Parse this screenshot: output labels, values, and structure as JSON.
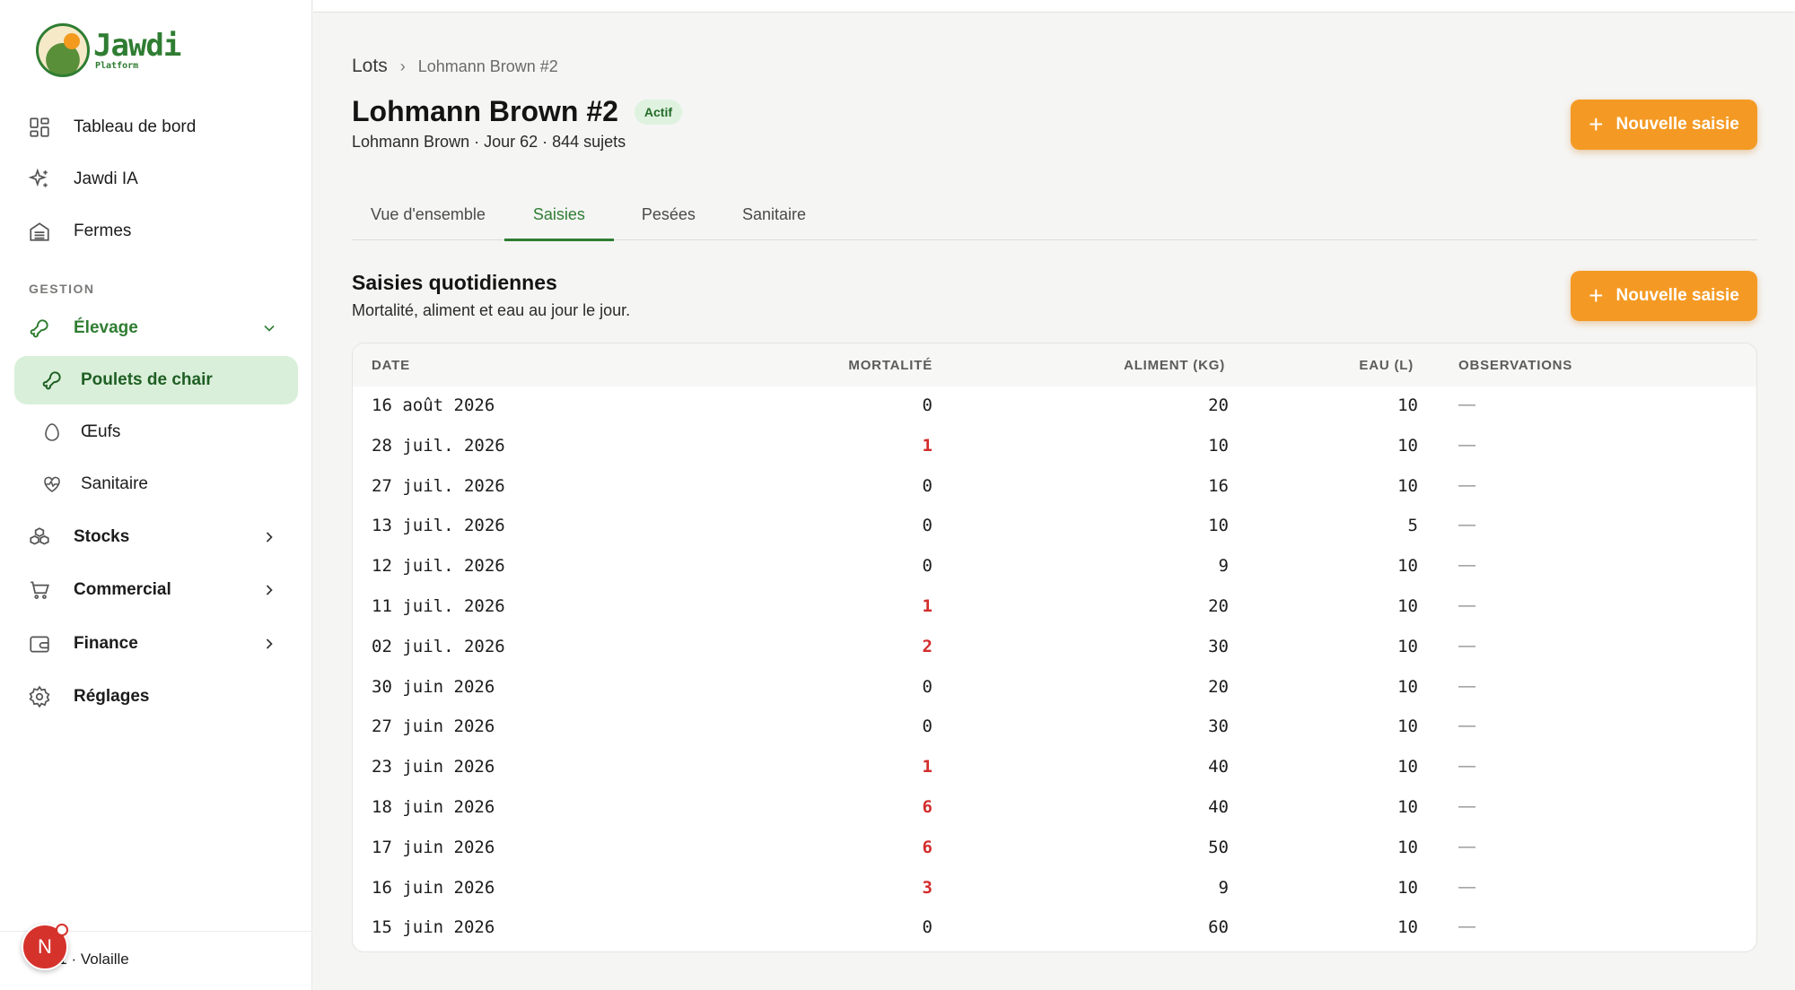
{
  "logo": {
    "name": "Jawdi",
    "sub": "Platform"
  },
  "nav": {
    "dashboard": "Tableau de bord",
    "ai": "Jawdi IA",
    "farms": "Fermes",
    "section": "GESTION",
    "breeding": "Élevage",
    "broilers": "Poulets de chair",
    "eggs": "Œufs",
    "health": "Sanitaire",
    "stocks": "Stocks",
    "commercial": "Commercial",
    "finance": "Finance",
    "settings": "Réglages"
  },
  "footer": {
    "avatar": "N",
    "version": "di V1 · Volaille"
  },
  "breadcrumb": {
    "root": "Lots",
    "current": "Lohmann Brown #2"
  },
  "header": {
    "title": "Lohmann Brown #2",
    "badge": "Actif",
    "subtitle": "Lohmann Brown · Jour 62 · 844 sujets",
    "new_entry": "Nouvelle saisie"
  },
  "tabs": [
    "Vue d'ensemble",
    "Saisies",
    "Pesées",
    "Sanitaire"
  ],
  "section": {
    "title": "Saisies quotidiennes",
    "desc": "Mortalité, aliment et eau au jour le jour.",
    "new_entry": "Nouvelle saisie"
  },
  "table": {
    "headers": [
      "DATE",
      "MORTALITÉ",
      "ALIMENT (KG)",
      "EAU (L)",
      "OBSERVATIONS"
    ],
    "rows": [
      [
        "16 août 2026",
        "0",
        "20",
        "10",
        "—"
      ],
      [
        "28 juil. 2026",
        "1",
        "10",
        "10",
        "—"
      ],
      [
        "27 juil. 2026",
        "0",
        "16",
        "10",
        "—"
      ],
      [
        "13 juil. 2026",
        "0",
        "10",
        "5",
        "—"
      ],
      [
        "12 juil. 2026",
        "0",
        "9",
        "10",
        "—"
      ],
      [
        "11 juil. 2026",
        "1",
        "20",
        "10",
        "—"
      ],
      [
        "02 juil. 2026",
        "2",
        "30",
        "10",
        "—"
      ],
      [
        "30 juin 2026",
        "0",
        "20",
        "10",
        "—"
      ],
      [
        "27 juin 2026",
        "0",
        "30",
        "10",
        "—"
      ],
      [
        "23 juin 2026",
        "1",
        "40",
        "10",
        "—"
      ],
      [
        "18 juin 2026",
        "6",
        "40",
        "10",
        "—"
      ],
      [
        "17 juin 2026",
        "6",
        "50",
        "10",
        "—"
      ],
      [
        "16 juin 2026",
        "3",
        "9",
        "10",
        "—"
      ],
      [
        "15 juin 2026",
        "0",
        "60",
        "10",
        "—"
      ]
    ]
  },
  "colors": {
    "accent": "#f49a24",
    "brand": "#2f7d32",
    "danger": "#d32d2d"
  }
}
